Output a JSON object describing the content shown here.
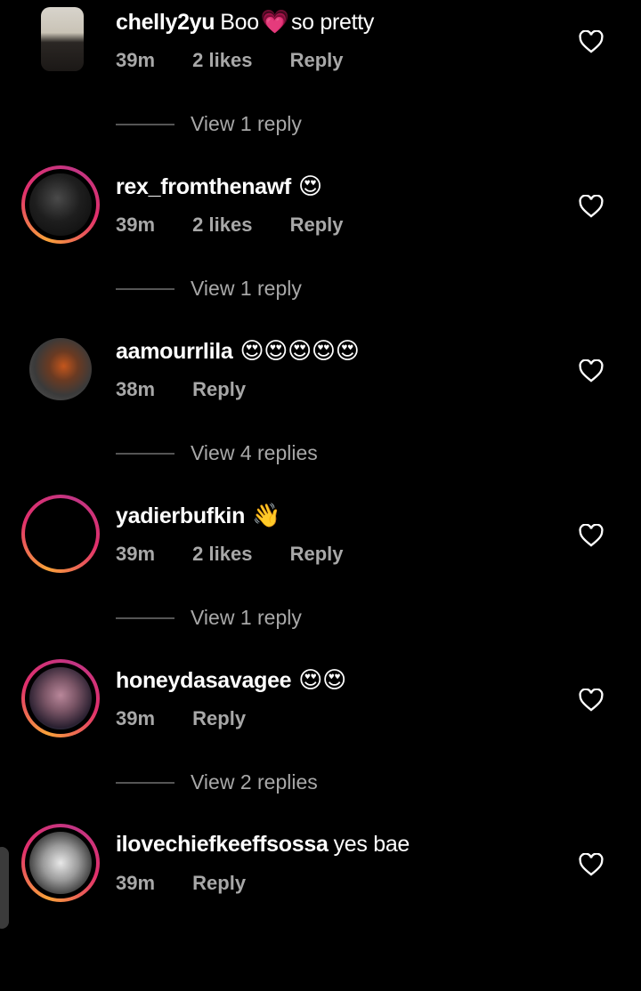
{
  "colors": {
    "background": "#000000",
    "meta_text": "#a8a8a8",
    "ring_start": "#f9a23a",
    "ring_end": "#c13584"
  },
  "comments": [
    {
      "username": "chelly2yu",
      "text_before": "Boo",
      "emoji": "💗",
      "text_after": "so pretty",
      "time": "39m",
      "likes": "2 likes",
      "reply": "Reply",
      "view_replies": "View 1 reply",
      "ring": false
    },
    {
      "username": "rex_fromthenawf",
      "text_before": "",
      "emoji": "😍",
      "text_after": "",
      "time": "39m",
      "likes": "2 likes",
      "reply": "Reply",
      "view_replies": "View 1 reply",
      "ring": true
    },
    {
      "username": "aamourrlila",
      "text_before": "",
      "emoji": "😍😍😍😍😍",
      "text_after": "",
      "time": "38m",
      "likes": "",
      "reply": "Reply",
      "view_replies": "View 4 replies",
      "ring": false
    },
    {
      "username": "yadierbufkin",
      "text_before": "",
      "emoji": "👋",
      "text_after": "",
      "time": "39m",
      "likes": "2 likes",
      "reply": "Reply",
      "view_replies": "View 1 reply",
      "ring": true
    },
    {
      "username": "honeydasavagee",
      "text_before": "",
      "emoji": "😍😍",
      "text_after": "",
      "time": "39m",
      "likes": "",
      "reply": "Reply",
      "view_replies": "View 2 replies",
      "ring": true
    },
    {
      "username": "ilovechiefkeeffsossa",
      "text_before": "yes bae",
      "emoji": "",
      "text_after": "",
      "time": "39m",
      "likes": "",
      "reply": "Reply",
      "view_replies": "",
      "ring": true
    }
  ]
}
